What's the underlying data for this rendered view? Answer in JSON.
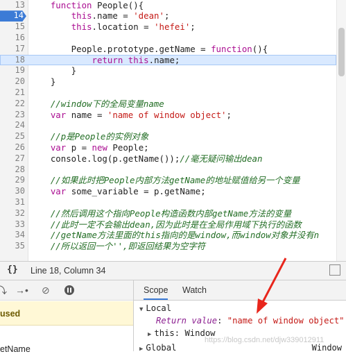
{
  "editor": {
    "lines": [
      {
        "num": "13",
        "parts": [
          {
            "t": "    ",
            "c": ""
          },
          {
            "t": "function",
            "c": "kw"
          },
          {
            "t": " People(){",
            "c": ""
          }
        ]
      },
      {
        "num": "14",
        "bp": true,
        "parts": [
          {
            "t": "        ",
            "c": ""
          },
          {
            "t": "this",
            "c": "kw"
          },
          {
            "t": ".name = ",
            "c": ""
          },
          {
            "t": "'dean'",
            "c": "str"
          },
          {
            "t": ";",
            "c": ""
          }
        ]
      },
      {
        "num": "15",
        "parts": [
          {
            "t": "        ",
            "c": ""
          },
          {
            "t": "this",
            "c": "kw"
          },
          {
            "t": ".location = ",
            "c": ""
          },
          {
            "t": "'hefei'",
            "c": "str"
          },
          {
            "t": ";",
            "c": ""
          }
        ]
      },
      {
        "num": "16",
        "parts": [
          {
            "t": "",
            "c": ""
          }
        ]
      },
      {
        "num": "17",
        "parts": [
          {
            "t": "        People.prototype.getName = ",
            "c": ""
          },
          {
            "t": "function",
            "c": "kw"
          },
          {
            "t": "(){",
            "c": ""
          }
        ]
      },
      {
        "num": "18",
        "exec": true,
        "parts": [
          {
            "t": "            ",
            "c": ""
          },
          {
            "t": "return",
            "c": "kw"
          },
          {
            "t": " ",
            "c": ""
          },
          {
            "t": "this",
            "c": "kw"
          },
          {
            "t": ".name;",
            "c": ""
          }
        ]
      },
      {
        "num": "19",
        "parts": [
          {
            "t": "        }",
            "c": ""
          }
        ]
      },
      {
        "num": "20",
        "parts": [
          {
            "t": "    }",
            "c": ""
          }
        ]
      },
      {
        "num": "21",
        "parts": [
          {
            "t": "",
            "c": ""
          }
        ]
      },
      {
        "num": "22",
        "parts": [
          {
            "t": "    ",
            "c": ""
          },
          {
            "t": "//window下的全局变量name",
            "c": "cm"
          }
        ]
      },
      {
        "num": "23",
        "parts": [
          {
            "t": "    ",
            "c": ""
          },
          {
            "t": "var",
            "c": "kw"
          },
          {
            "t": " name = ",
            "c": ""
          },
          {
            "t": "'name of window object'",
            "c": "str"
          },
          {
            "t": ";",
            "c": ""
          }
        ]
      },
      {
        "num": "24",
        "parts": [
          {
            "t": "",
            "c": ""
          }
        ]
      },
      {
        "num": "25",
        "parts": [
          {
            "t": "    ",
            "c": ""
          },
          {
            "t": "//p是People的实例对象",
            "c": "cm"
          }
        ]
      },
      {
        "num": "26",
        "parts": [
          {
            "t": "    ",
            "c": ""
          },
          {
            "t": "var",
            "c": "kw"
          },
          {
            "t": " p = ",
            "c": ""
          },
          {
            "t": "new",
            "c": "kw"
          },
          {
            "t": " People;",
            "c": ""
          }
        ]
      },
      {
        "num": "27",
        "parts": [
          {
            "t": "    console.log(p.getName());",
            "c": ""
          },
          {
            "t": "//毫无疑问输出dean",
            "c": "cm"
          }
        ]
      },
      {
        "num": "28",
        "parts": [
          {
            "t": "",
            "c": ""
          }
        ]
      },
      {
        "num": "29",
        "parts": [
          {
            "t": "    ",
            "c": ""
          },
          {
            "t": "//如果此时把People内部方法getName的地址赋值给另一个变量",
            "c": "cm"
          }
        ]
      },
      {
        "num": "30",
        "parts": [
          {
            "t": "    ",
            "c": ""
          },
          {
            "t": "var",
            "c": "kw"
          },
          {
            "t": " some_variable = p.getName;",
            "c": ""
          }
        ]
      },
      {
        "num": "31",
        "parts": [
          {
            "t": "",
            "c": ""
          }
        ]
      },
      {
        "num": "32",
        "parts": [
          {
            "t": "    ",
            "c": ""
          },
          {
            "t": "//然后调用这个指向People构造函数内部getName方法的变量",
            "c": "cm"
          }
        ]
      },
      {
        "num": "33",
        "parts": [
          {
            "t": "    ",
            "c": ""
          },
          {
            "t": "//此时一定不会输出dean,因为此时是在全局作用域下执行的函数",
            "c": "cm"
          }
        ]
      },
      {
        "num": "34",
        "parts": [
          {
            "t": "    ",
            "c": ""
          },
          {
            "t": "//getName方法里面的this指向的是window,而window对象并没有n",
            "c": "cm"
          }
        ]
      },
      {
        "num": "35",
        "parts": [
          {
            "t": "    ",
            "c": ""
          },
          {
            "t": "//所以返回一个'',即返回结果为空字符",
            "c": "cm"
          }
        ]
      }
    ]
  },
  "status": {
    "braces": "{}",
    "position": "Line 18, Column 34"
  },
  "debugger": {
    "paused_label": "used",
    "stack_item": "etName",
    "tabs": [
      "Scope",
      "Watch"
    ],
    "scope": {
      "local": "Local",
      "return_key": "Return value",
      "return_val": "\"name of window object\"",
      "this_key": "this",
      "this_val": "Window",
      "global": "Global",
      "global_val": "Window"
    }
  },
  "watermark": "https://blog.csdn.net/djw339012911",
  "colors": {
    "accent": "#3c7bd6",
    "exec_line": "#d9e9ff",
    "arrow": "#e8261c",
    "keyword": "#aa0d91",
    "string": "#c41a16",
    "comment": "#236e25"
  }
}
